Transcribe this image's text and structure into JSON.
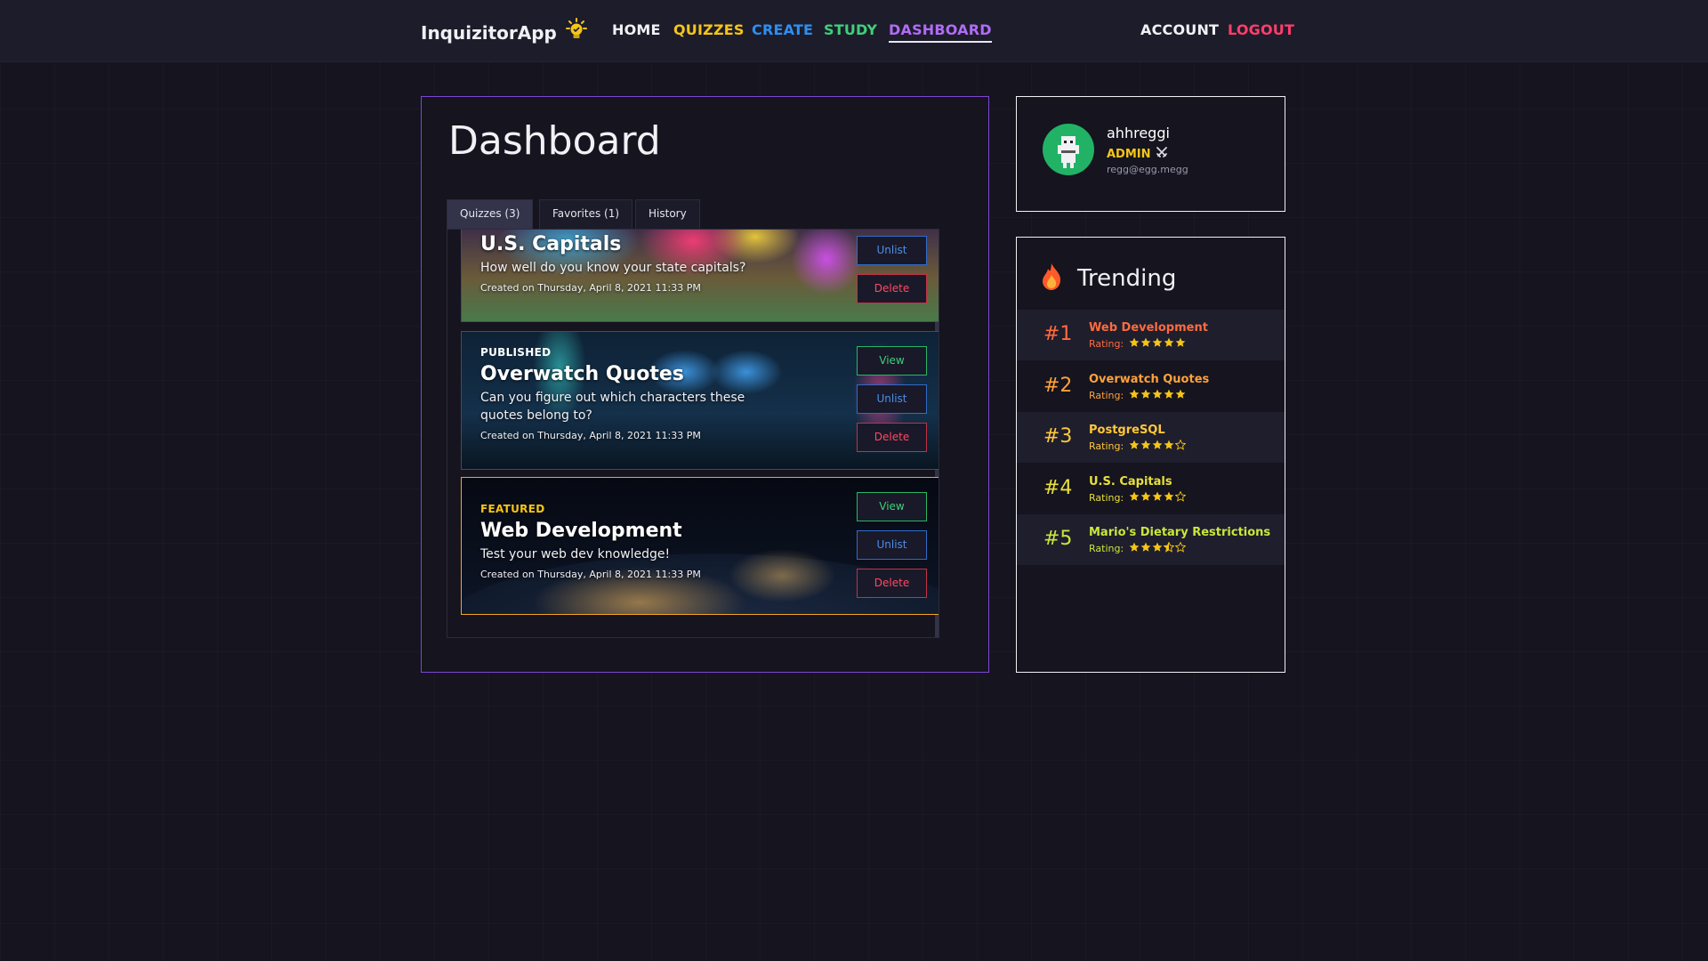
{
  "nav": {
    "brand": "InquizitorApp",
    "links": [
      {
        "label": "HOME",
        "color": "#f1f1f5"
      },
      {
        "label": "QUIZZES",
        "color": "#f5c518"
      },
      {
        "label": "CREATE",
        "color": "#2d8ff0"
      },
      {
        "label": "STUDY",
        "color": "#3fd07a"
      },
      {
        "label": "DASHBOARD",
        "color": "#b06cf5"
      }
    ],
    "account": "ACCOUNT",
    "logout": "LOGOUT",
    "colors": {
      "account": "#f1f1f5",
      "logout": "#ff3e6c"
    }
  },
  "dashboard": {
    "title": "Dashboard",
    "tabs": [
      "Quizzes (3)",
      "Favorites (1)",
      "History"
    ],
    "active_tab": "Quizzes (3)",
    "cards": [
      {
        "status": "",
        "title": "U.S. Capitals",
        "description": "How well do you know your state capitals?",
        "date": "Created on Thursday, April 8, 2021 11:33 PM",
        "buttons": [
          "Unlist",
          "Delete"
        ]
      },
      {
        "status": "PUBLISHED",
        "title": "Overwatch Quotes",
        "description": "Can you figure out which characters these quotes belong to?",
        "date": "Created on Thursday, April 8, 2021 11:33 PM",
        "buttons": [
          "View",
          "Unlist",
          "Delete"
        ]
      },
      {
        "status": "FEATURED",
        "title": "Web Development",
        "description": "Test your web dev knowledge!",
        "date": "Created on Thursday, April 8, 2021 11:33 PM",
        "buttons": [
          "View",
          "Unlist",
          "Delete"
        ]
      }
    ]
  },
  "profile": {
    "username": "ahhreggi",
    "role": "ADMIN",
    "email": "regg@egg.megg"
  },
  "trending": {
    "title": "Trending",
    "rating_label": "Rating:",
    "items": [
      {
        "rank": "#1",
        "name": "Web Development",
        "rating": 5,
        "color": "#ff6b3d"
      },
      {
        "rank": "#2",
        "name": "Overwatch Quotes",
        "rating": 5,
        "color": "#ffa23a"
      },
      {
        "rank": "#3",
        "name": "PostgreSQL",
        "rating": 4,
        "color": "#ffc83a"
      },
      {
        "rank": "#4",
        "name": "U.S. Capitals",
        "rating": 4,
        "color": "#e8e03a"
      },
      {
        "rank": "#5",
        "name": "Mario's Dietary Restrictions",
        "rating": 3.5,
        "color": "#c8e83a"
      }
    ]
  }
}
